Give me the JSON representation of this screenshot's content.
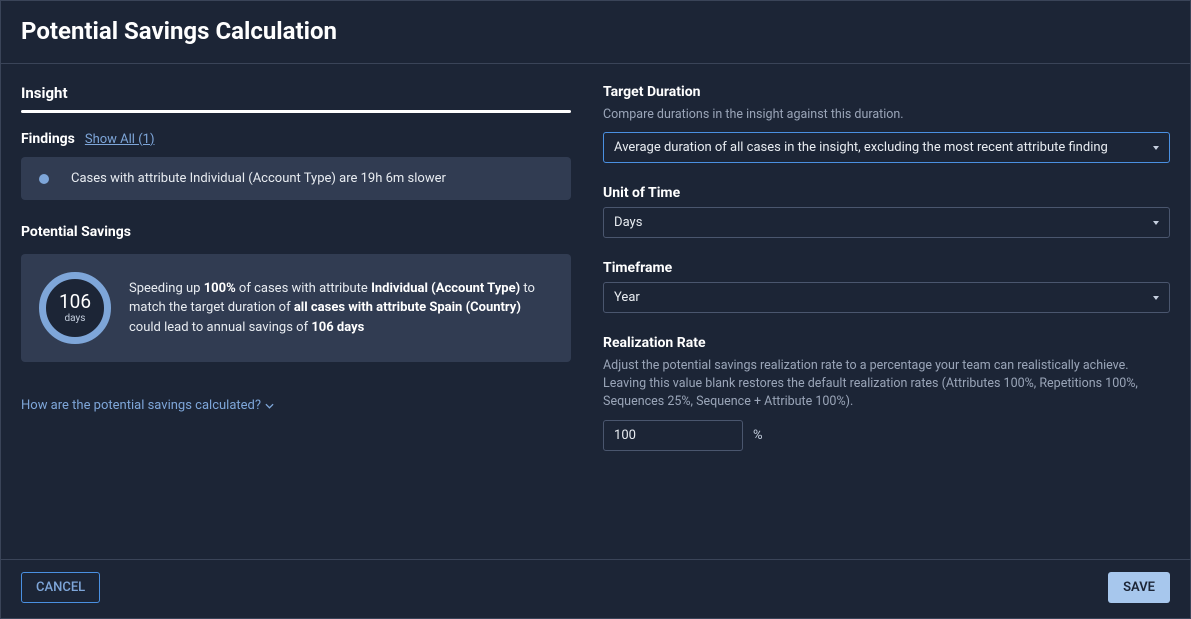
{
  "header": {
    "title": "Potential Savings Calculation"
  },
  "insight": {
    "tab_label": "Insight",
    "findings_label": "Findings",
    "show_all_label": "Show All (1)",
    "finding_text": "Cases with attribute Individual (Account Type) are 19h 6m slower",
    "potential_label": "Potential Savings",
    "donut_value": "106",
    "donut_unit": "days",
    "savings_prefix": "Speeding up ",
    "savings_percent": "100%",
    "savings_mid1": " of cases with attribute ",
    "savings_attr1": "Individual (Account Type)",
    "savings_mid2": " to match the target duration of ",
    "savings_attr2": "all cases with attribute Spain (Country)",
    "savings_mid3": " could lead to annual savings of ",
    "savings_result": "106 days",
    "help_link": "How are the potential savings calculated?"
  },
  "form": {
    "target_duration": {
      "label": "Target Duration",
      "help": "Compare durations in the insight against this duration.",
      "value": "Average duration of all cases in the insight, excluding the most recent attribute finding"
    },
    "unit_of_time": {
      "label": "Unit of Time",
      "value": "Days"
    },
    "timeframe": {
      "label": "Timeframe",
      "value": "Year"
    },
    "realization_rate": {
      "label": "Realization Rate",
      "help": "Adjust the potential savings realization rate to a percentage your team can realistically achieve. Leaving this value blank restores the default realization rates (Attributes 100%, Repetitions 100%, Sequences 25%, Sequence + Attribute 100%).",
      "value": "100",
      "suffix": "%"
    }
  },
  "footer": {
    "cancel": "CANCEL",
    "save": "SAVE"
  }
}
